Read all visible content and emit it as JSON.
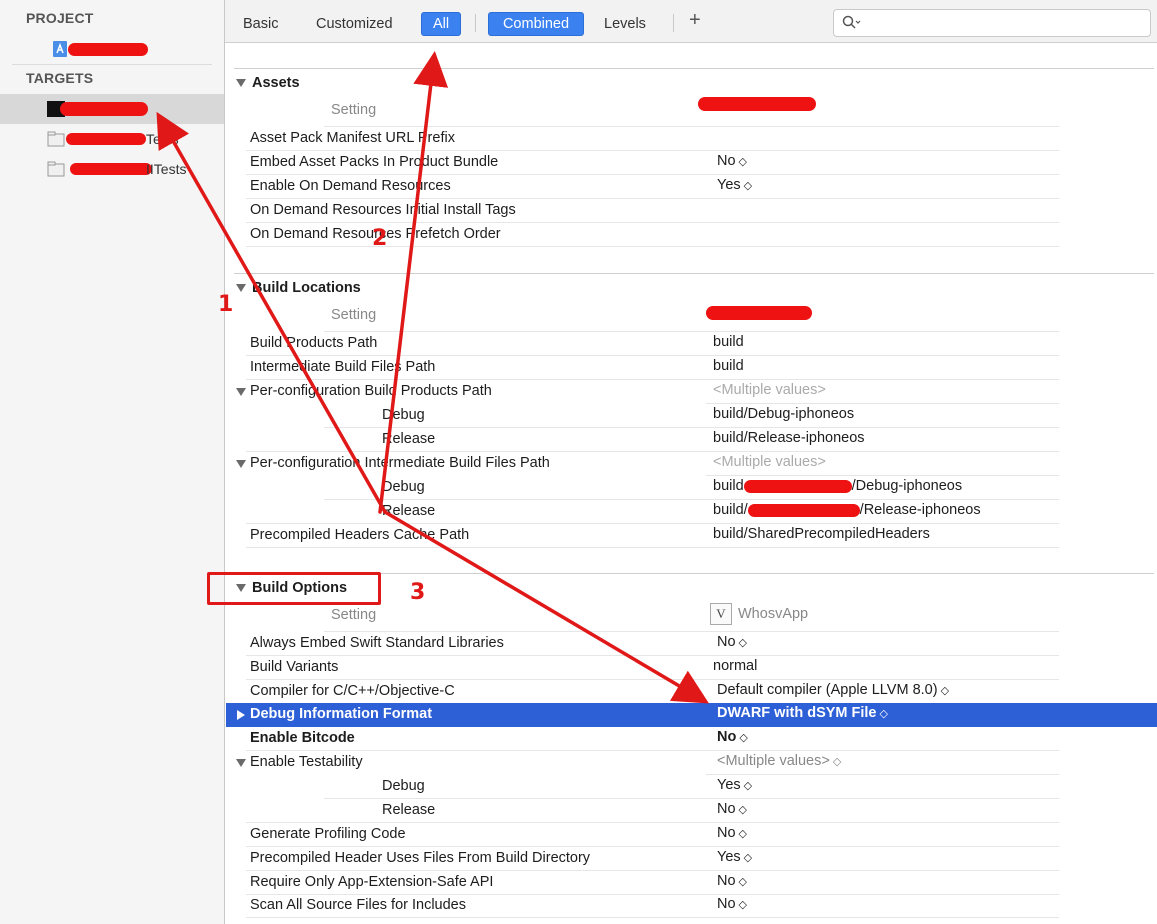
{
  "sidebar": {
    "project_header": "PROJECT",
    "targets_header": "TARGETS",
    "items": [
      {
        "label": "",
        "kind": "project"
      },
      {
        "label": "",
        "kind": "app-target"
      },
      {
        "label": "Tests",
        "kind": "test-target"
      },
      {
        "label": "IITests",
        "kind": "test-target"
      }
    ]
  },
  "toolbar": {
    "tabs": [
      "Basic",
      "Customized",
      "All",
      "Combined",
      "Levels"
    ],
    "selected_scope": "All",
    "selected_view": "Combined",
    "add_label": "+",
    "search_placeholder": "",
    "accent": "#3b82f0"
  },
  "sections": {
    "assets": {
      "title": "Assets",
      "col_setting": "Setting",
      "rows": [
        {
          "name": "Asset Pack Manifest URL Prefix",
          "value": ""
        },
        {
          "name": "Embed Asset Packs In Product Bundle",
          "value": "No"
        },
        {
          "name": "Enable On Demand Resources",
          "value": "Yes"
        },
        {
          "name": "On Demand Resources Initial Install Tags",
          "value": ""
        },
        {
          "name": "On Demand Resources Prefetch Order",
          "value": ""
        }
      ]
    },
    "build_locations": {
      "title": "Build Locations",
      "col_setting": "Setting",
      "rows": [
        {
          "name": "Build Products Path",
          "value": "build"
        },
        {
          "name": "Intermediate Build Files Path",
          "value": "build"
        },
        {
          "name": "Per-configuration Build Products Path",
          "value": "<Multiple values>"
        },
        {
          "name": "Debug",
          "value": "build/Debug-iphoneos"
        },
        {
          "name": "Release",
          "value": "build/Release-iphoneos"
        },
        {
          "name": "Per-configuration Intermediate Build Files Path",
          "value": "<Multiple values>"
        },
        {
          "name": "Debug",
          "value_prefix": "build",
          "value_suffix": "/Debug-iphoneos"
        },
        {
          "name": "Release",
          "value_prefix": "build/",
          "value_suffix": "/Release-iphoneos"
        },
        {
          "name": "Precompiled Headers Cache Path",
          "value": "build/SharedPrecompiledHeaders"
        }
      ]
    },
    "build_options": {
      "title": "Build Options",
      "col_setting": "Setting",
      "target_name": "WhosvApp",
      "target_badge": "V",
      "rows": [
        {
          "name": "Always Embed Swift Standard Libraries",
          "value": "No"
        },
        {
          "name": "Build Variants",
          "value": "normal"
        },
        {
          "name": "Compiler for C/C++/Objective-C",
          "value": "Default compiler (Apple LLVM 8.0)"
        },
        {
          "name": "Debug Information Format",
          "value": "DWARF with dSYM File"
        },
        {
          "name": "Enable Bitcode",
          "value": "No"
        },
        {
          "name": "Enable Testability",
          "value": "<Multiple values>"
        },
        {
          "name": "Debug",
          "value": "Yes"
        },
        {
          "name": "Release",
          "value": "No"
        },
        {
          "name": "Generate Profiling Code",
          "value": "No"
        },
        {
          "name": "Precompiled Header Uses Files From Build Directory",
          "value": "Yes"
        },
        {
          "name": "Require Only App-Extension-Safe API",
          "value": "No"
        },
        {
          "name": "Scan All Source Files for Includes",
          "value": "No"
        }
      ]
    }
  },
  "annotations": {
    "label_1": "1",
    "label_2": "2",
    "label_3": "3",
    "color": "#e01818"
  },
  "colors": {
    "selection": "#2d5fd6",
    "redaction": "#ee1212"
  }
}
